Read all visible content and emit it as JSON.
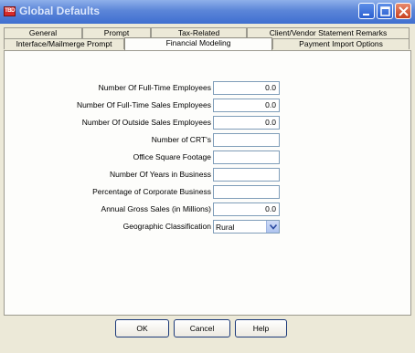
{
  "window": {
    "title": "Global Defaults",
    "app_icon_text": "TBD"
  },
  "tabs_row1": [
    {
      "label": "General"
    },
    {
      "label": "Prompt"
    },
    {
      "label": "Tax-Related"
    },
    {
      "label": "Client/Vendor Statement Remarks"
    }
  ],
  "tabs_row2": [
    {
      "label": "Interface/Mailmerge Prompt"
    },
    {
      "label": "Financial Modeling",
      "active": true
    },
    {
      "label": "Payment Import Options"
    }
  ],
  "form": {
    "fields": [
      {
        "label": "Number Of Full-Time Employees",
        "value": "0.0"
      },
      {
        "label": "Number Of Full-Time Sales Employees",
        "value": "0.0"
      },
      {
        "label": "Number Of Outside Sales Employees",
        "value": "0.0"
      },
      {
        "label": "Number of CRT's",
        "value": ""
      },
      {
        "label": "Office Square Footage",
        "value": ""
      },
      {
        "label": "Number Of Years in Business",
        "value": ""
      },
      {
        "label": "Percentage of Corporate Business",
        "value": ""
      },
      {
        "label": "Annual Gross Sales (in Millions)",
        "value": "0.0"
      }
    ],
    "geo": {
      "label": "Geographic Classification",
      "value": "Rural"
    }
  },
  "buttons": {
    "ok": "OK",
    "cancel": "Cancel",
    "help": "Help"
  },
  "colors": {
    "titlebar": "#3f6fd0",
    "face": "#ece9d8",
    "close": "#c8401e"
  }
}
